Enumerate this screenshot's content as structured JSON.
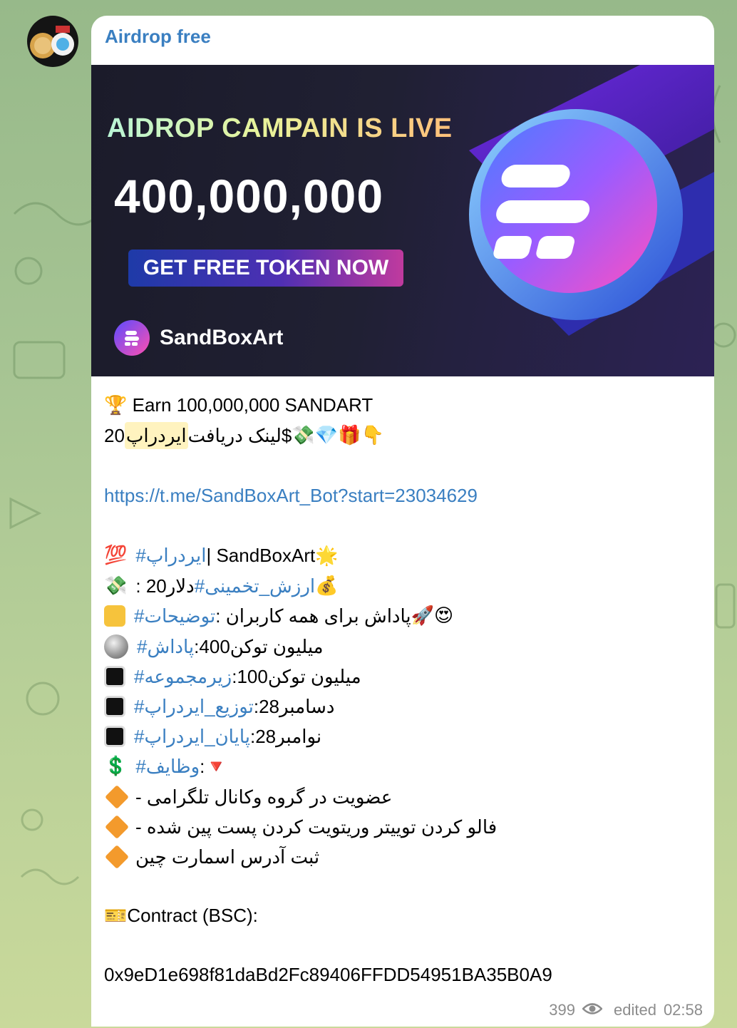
{
  "channel": {
    "name": "Airdrop free"
  },
  "banner": {
    "headline": "AIDROP CAMPAIN IS LIVE",
    "amount": "400,000,000",
    "cta": "GET FREE TOKEN NOW",
    "brand": "SandBoxArt"
  },
  "message": {
    "line1": "🏆 Earn 100,000,000 SANDART",
    "line2_prefix": "20 ",
    "line2_hl": "ایردراپ",
    "line2_text": "$لینک دریافت",
    "line2_emoji": "💸💎🎁👇",
    "link": "https://t.me/SandBoxArt_Bot?start=23034629",
    "tag_line": {
      "emoji": "💯",
      "tag": "#ایردراپ",
      "text": " | SandBoxArt🌟"
    },
    "value_line": {
      "emoji": "💸",
      "tag": "#ارزش_تخمینی",
      "text": ": 20دلار",
      "emoji2": "💰"
    },
    "desc_line": {
      "tag": "#توضیحات",
      "text": ": پاداش برای همه کاربران",
      "emoji2": "🚀😍"
    },
    "reward_line": {
      "tag": "#پاداش",
      "text": ":400میلیون توکن"
    },
    "ref_line": {
      "tag": "#زیرمجموعه",
      "text": ":100میلیون توکن"
    },
    "dist_line": {
      "tag": "#توزیع_ایردراپ",
      "text": ":28دسامبر"
    },
    "end_line": {
      "tag": "#پایان_ایردراپ",
      "text": ":28نوامبر"
    },
    "tasks_line": {
      "emoji": "💲",
      "tag": "#وظایف",
      "text": ":🔻"
    },
    "task1": "عضویت در گروه وکانال تلگرامی -",
    "task2": "فالو کردن توییتر وریتویت کردن پست پین شده -",
    "task3": "ثبت آدرس اسمارت چین",
    "contract_label": "🎫Contract (BSC):",
    "contract_address": "0x9eD1e698f81daBd2Fc89406FFDD54951BA35B0A9"
  },
  "footer": {
    "views": "399",
    "edited": "edited",
    "time": "02:58"
  }
}
